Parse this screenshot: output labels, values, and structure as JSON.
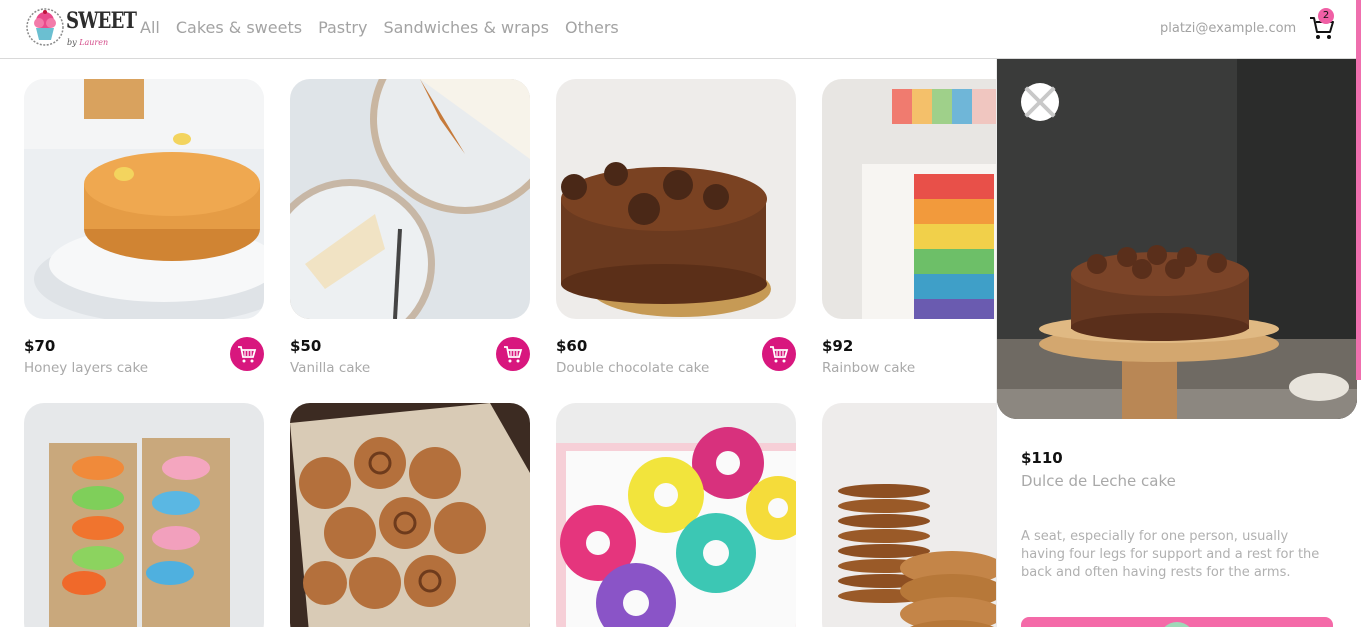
{
  "brand": {
    "name": "SWEET",
    "byline_prefix": "by",
    "byline_name": "Lauren"
  },
  "nav": {
    "links": [
      {
        "label": "All"
      },
      {
        "label": "Cakes & sweets"
      },
      {
        "label": "Pastry"
      },
      {
        "label": "Sandwiches & wraps"
      },
      {
        "label": "Others"
      }
    ],
    "email": "platzi@example.com",
    "cart_icon": "shopping-cart-icon",
    "cart_count": "2"
  },
  "products": [
    {
      "price": "$70",
      "name": "Honey layers cake"
    },
    {
      "price": "$50",
      "name": "Vanilla cake"
    },
    {
      "price": "$60",
      "name": "Double chocolate cake"
    },
    {
      "price": "$92",
      "name": "Rainbow cake"
    }
  ],
  "detail": {
    "price": "$110",
    "name": "Dulce de Leche cake",
    "description": "A seat, especially for one person, usually having four legs for support and a rest for the back and often having rests for the arms.",
    "close_icon": "close-icon"
  },
  "colors": {
    "accent": "#d8177e",
    "accent_light": "#f46aa8",
    "muted": "#a3a3a3"
  }
}
